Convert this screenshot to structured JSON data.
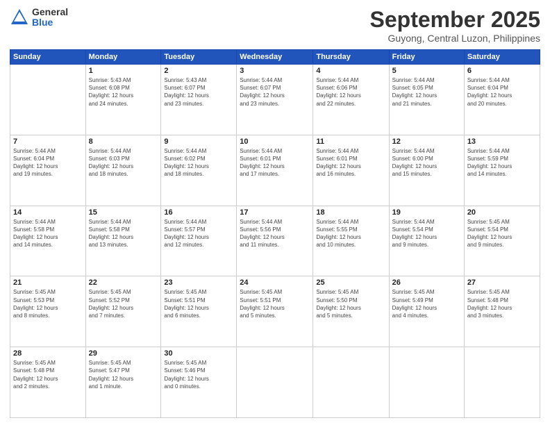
{
  "logo": {
    "general": "General",
    "blue": "Blue"
  },
  "header": {
    "month": "September 2025",
    "location": "Guyong, Central Luzon, Philippines"
  },
  "weekdays": [
    "Sunday",
    "Monday",
    "Tuesday",
    "Wednesday",
    "Thursday",
    "Friday",
    "Saturday"
  ],
  "weeks": [
    [
      {
        "day": "",
        "info": ""
      },
      {
        "day": "1",
        "info": "Sunrise: 5:43 AM\nSunset: 6:08 PM\nDaylight: 12 hours\nand 24 minutes."
      },
      {
        "day": "2",
        "info": "Sunrise: 5:43 AM\nSunset: 6:07 PM\nDaylight: 12 hours\nand 23 minutes."
      },
      {
        "day": "3",
        "info": "Sunrise: 5:44 AM\nSunset: 6:07 PM\nDaylight: 12 hours\nand 23 minutes."
      },
      {
        "day": "4",
        "info": "Sunrise: 5:44 AM\nSunset: 6:06 PM\nDaylight: 12 hours\nand 22 minutes."
      },
      {
        "day": "5",
        "info": "Sunrise: 5:44 AM\nSunset: 6:05 PM\nDaylight: 12 hours\nand 21 minutes."
      },
      {
        "day": "6",
        "info": "Sunrise: 5:44 AM\nSunset: 6:04 PM\nDaylight: 12 hours\nand 20 minutes."
      }
    ],
    [
      {
        "day": "7",
        "info": "Sunrise: 5:44 AM\nSunset: 6:04 PM\nDaylight: 12 hours\nand 19 minutes."
      },
      {
        "day": "8",
        "info": "Sunrise: 5:44 AM\nSunset: 6:03 PM\nDaylight: 12 hours\nand 18 minutes."
      },
      {
        "day": "9",
        "info": "Sunrise: 5:44 AM\nSunset: 6:02 PM\nDaylight: 12 hours\nand 18 minutes."
      },
      {
        "day": "10",
        "info": "Sunrise: 5:44 AM\nSunset: 6:01 PM\nDaylight: 12 hours\nand 17 minutes."
      },
      {
        "day": "11",
        "info": "Sunrise: 5:44 AM\nSunset: 6:01 PM\nDaylight: 12 hours\nand 16 minutes."
      },
      {
        "day": "12",
        "info": "Sunrise: 5:44 AM\nSunset: 6:00 PM\nDaylight: 12 hours\nand 15 minutes."
      },
      {
        "day": "13",
        "info": "Sunrise: 5:44 AM\nSunset: 5:59 PM\nDaylight: 12 hours\nand 14 minutes."
      }
    ],
    [
      {
        "day": "14",
        "info": "Sunrise: 5:44 AM\nSunset: 5:58 PM\nDaylight: 12 hours\nand 14 minutes."
      },
      {
        "day": "15",
        "info": "Sunrise: 5:44 AM\nSunset: 5:58 PM\nDaylight: 12 hours\nand 13 minutes."
      },
      {
        "day": "16",
        "info": "Sunrise: 5:44 AM\nSunset: 5:57 PM\nDaylight: 12 hours\nand 12 minutes."
      },
      {
        "day": "17",
        "info": "Sunrise: 5:44 AM\nSunset: 5:56 PM\nDaylight: 12 hours\nand 11 minutes."
      },
      {
        "day": "18",
        "info": "Sunrise: 5:44 AM\nSunset: 5:55 PM\nDaylight: 12 hours\nand 10 minutes."
      },
      {
        "day": "19",
        "info": "Sunrise: 5:44 AM\nSunset: 5:54 PM\nDaylight: 12 hours\nand 9 minutes."
      },
      {
        "day": "20",
        "info": "Sunrise: 5:45 AM\nSunset: 5:54 PM\nDaylight: 12 hours\nand 9 minutes."
      }
    ],
    [
      {
        "day": "21",
        "info": "Sunrise: 5:45 AM\nSunset: 5:53 PM\nDaylight: 12 hours\nand 8 minutes."
      },
      {
        "day": "22",
        "info": "Sunrise: 5:45 AM\nSunset: 5:52 PM\nDaylight: 12 hours\nand 7 minutes."
      },
      {
        "day": "23",
        "info": "Sunrise: 5:45 AM\nSunset: 5:51 PM\nDaylight: 12 hours\nand 6 minutes."
      },
      {
        "day": "24",
        "info": "Sunrise: 5:45 AM\nSunset: 5:51 PM\nDaylight: 12 hours\nand 5 minutes."
      },
      {
        "day": "25",
        "info": "Sunrise: 5:45 AM\nSunset: 5:50 PM\nDaylight: 12 hours\nand 5 minutes."
      },
      {
        "day": "26",
        "info": "Sunrise: 5:45 AM\nSunset: 5:49 PM\nDaylight: 12 hours\nand 4 minutes."
      },
      {
        "day": "27",
        "info": "Sunrise: 5:45 AM\nSunset: 5:48 PM\nDaylight: 12 hours\nand 3 minutes."
      }
    ],
    [
      {
        "day": "28",
        "info": "Sunrise: 5:45 AM\nSunset: 5:48 PM\nDaylight: 12 hours\nand 2 minutes."
      },
      {
        "day": "29",
        "info": "Sunrise: 5:45 AM\nSunset: 5:47 PM\nDaylight: 12 hours\nand 1 minute."
      },
      {
        "day": "30",
        "info": "Sunrise: 5:45 AM\nSunset: 5:46 PM\nDaylight: 12 hours\nand 0 minutes."
      },
      {
        "day": "",
        "info": ""
      },
      {
        "day": "",
        "info": ""
      },
      {
        "day": "",
        "info": ""
      },
      {
        "day": "",
        "info": ""
      }
    ]
  ]
}
